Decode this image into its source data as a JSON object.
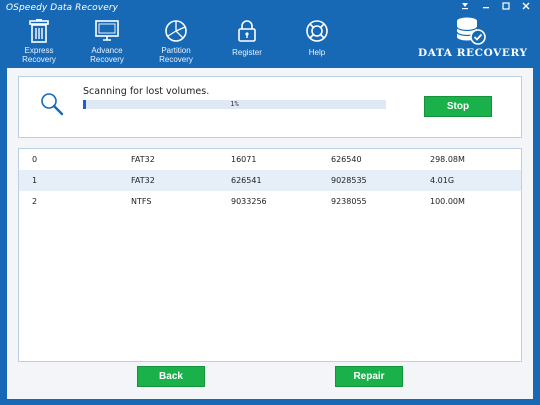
{
  "app": {
    "title": "OSpeedy Data Recovery"
  },
  "window": {
    "controls": [
      "menu-icon",
      "minimize-icon",
      "maximize-icon",
      "close-icon"
    ]
  },
  "toolbar": {
    "items": [
      {
        "line1": "Express",
        "line2": "Recovery",
        "icon": "trash-bin-icon"
      },
      {
        "line1": "Advance",
        "line2": "Recovery",
        "icon": "monitor-icon"
      },
      {
        "line1": "Partition",
        "line2": "Recovery",
        "icon": "pie-chart-icon"
      },
      {
        "line1": "Register",
        "line2": "",
        "icon": "lock-icon"
      },
      {
        "line1": "Help",
        "line2": "",
        "icon": "lifebuoy-icon"
      }
    ]
  },
  "brand": {
    "text": "DATA RECOVERY",
    "icon": "database-check-icon"
  },
  "scan": {
    "status": "Scanning for lost volumes.",
    "progress_percent": 1,
    "progress_text": "1%",
    "stop_label": "Stop"
  },
  "volumes": [
    {
      "index": "0",
      "fs": "FAT32",
      "start": "16071",
      "end": "626540",
      "size": "298.08M"
    },
    {
      "index": "1",
      "fs": "FAT32",
      "start": "626541",
      "end": "9028535",
      "size": "4.01G"
    },
    {
      "index": "2",
      "fs": "NTFS",
      "start": "9033256",
      "end": "9238055",
      "size": "100.00M"
    }
  ],
  "footer": {
    "back_label": "Back",
    "repair_label": "Repair"
  },
  "colors": {
    "frame": "#1769b6",
    "button": "#1ab04a",
    "progress": "#1f5fc8",
    "row_alt": "#e6eef8"
  }
}
